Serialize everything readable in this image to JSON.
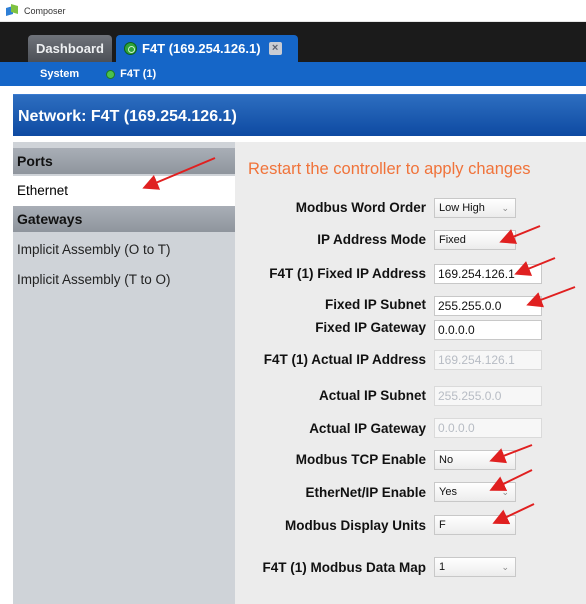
{
  "window": {
    "title": "Composer"
  },
  "tabs": {
    "dashboard": "Dashboard",
    "active": "F4T (169.254.126.1)"
  },
  "subnav": {
    "system": "System",
    "device": "F4T (1)"
  },
  "page": {
    "header": "Network: F4T (169.254.126.1)"
  },
  "sidebar": {
    "groups": [
      {
        "label": "Ports",
        "items": [
          "Ethernet"
        ]
      },
      {
        "label": "Gateways",
        "items": [
          "Implicit Assembly (O to T)",
          "Implicit Assembly (T to O)"
        ]
      }
    ],
    "selected": "Ethernet"
  },
  "notice": "Restart the controller to apply changes",
  "form": {
    "modbus_word_order": {
      "label": "Modbus Word Order",
      "value": "Low High"
    },
    "ip_address_mode": {
      "label": "IP Address Mode",
      "value": "Fixed"
    },
    "fixed_ip_address": {
      "label": "F4T (1) Fixed IP Address",
      "value": "169.254.126.1"
    },
    "fixed_ip_subnet": {
      "label": "Fixed IP Subnet",
      "value": "255.255.0.0"
    },
    "fixed_ip_gateway": {
      "label": "Fixed IP Gateway",
      "value": "0.0.0.0"
    },
    "actual_ip_address": {
      "label": "F4T (1) Actual IP Address",
      "value": "169.254.126.1"
    },
    "actual_ip_subnet": {
      "label": "Actual IP Subnet",
      "value": "255.255.0.0"
    },
    "actual_ip_gateway": {
      "label": "Actual IP Gateway",
      "value": "0.0.0.0"
    },
    "modbus_tcp_enable": {
      "label": "Modbus TCP Enable",
      "value": "No"
    },
    "ethernet_ip_enable": {
      "label": "EtherNet/IP Enable",
      "value": "Yes"
    },
    "modbus_display_units": {
      "label": "Modbus Display Units",
      "value": "F"
    },
    "modbus_data_map": {
      "label": "F4T (1) Modbus Data Map",
      "value": "1"
    }
  },
  "colors": {
    "accent_blue": "#1566c8",
    "notice_orange": "#f0733a",
    "annotation_red": "#e02020"
  }
}
